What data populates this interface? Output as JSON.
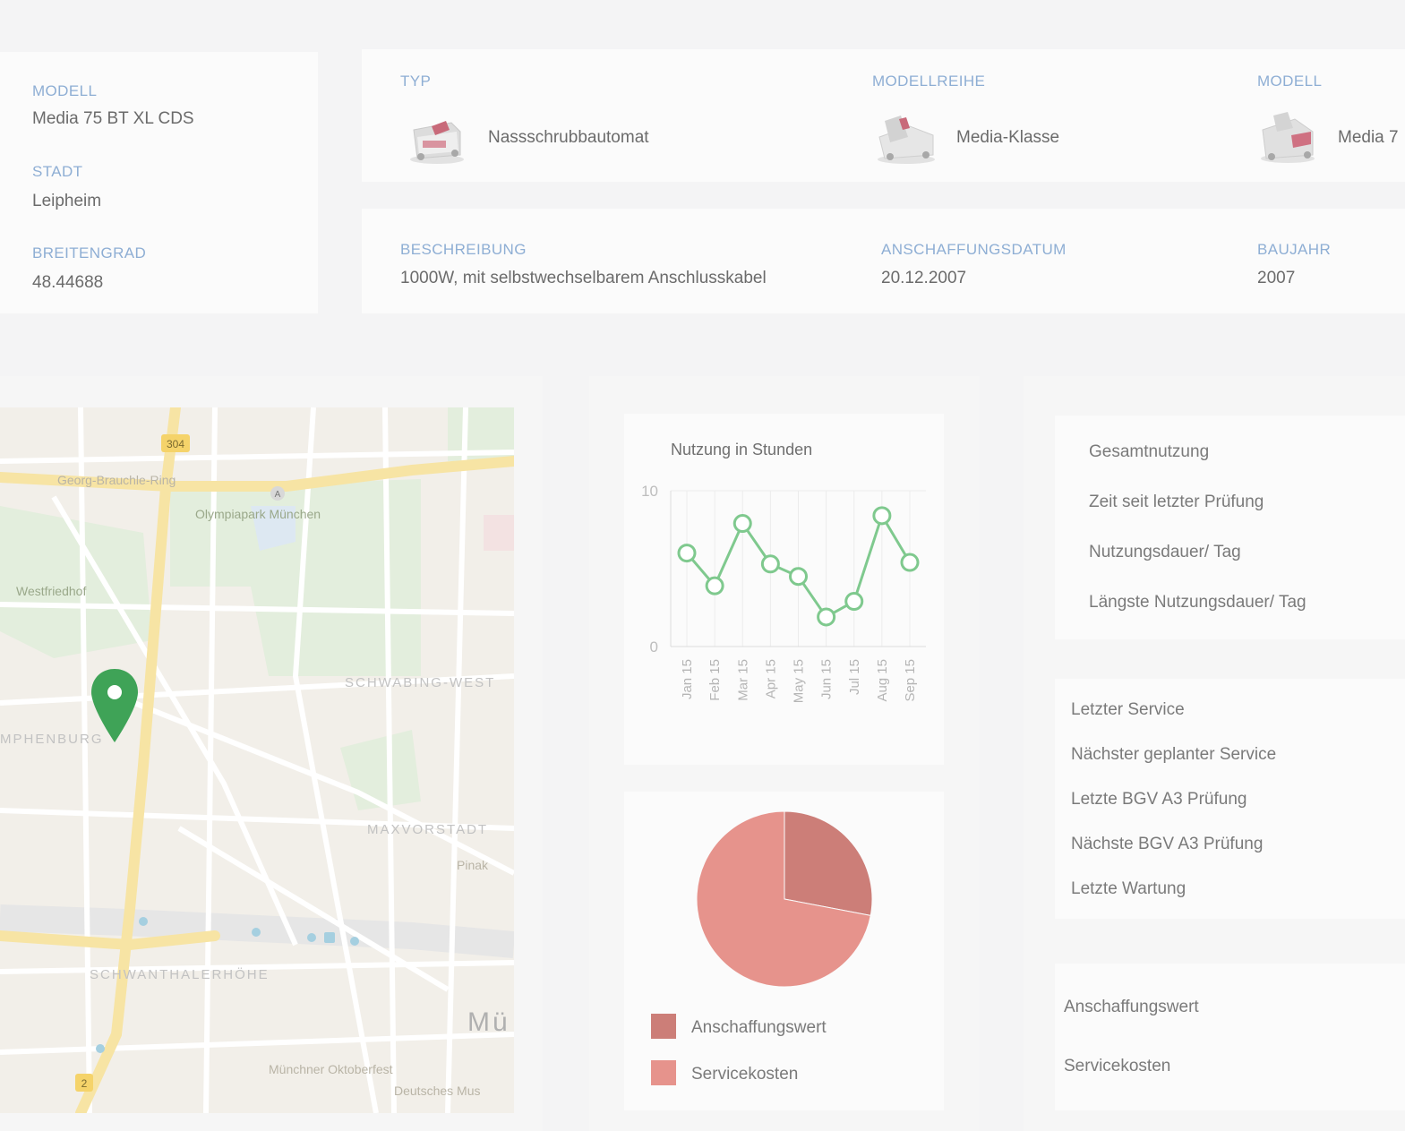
{
  "info_left": {
    "modell_label": "MODELL",
    "modell_value": "Media 75 BT XL CDS",
    "stadt_label": "STADT",
    "stadt_value": "Leipheim",
    "breitengrad_label": "BREITENGRAD",
    "breitengrad_value": "48.44688"
  },
  "type_card": {
    "typ_label": "TYP",
    "typ_value": "Nassschrubbautomat",
    "modellreihe_label": "MODELLREIHE",
    "modellreihe_value": "Media-Klasse",
    "modell_label": "MODELL",
    "modell_value": "Media 7"
  },
  "desc_card": {
    "beschreibung_label": "BESCHREIBUNG",
    "beschreibung_value": "1000W, mit selbstwechselbarem Anschlusskabel",
    "anschaffungsdatum_label": "ANSCHAFFUNGSDATUM",
    "anschaffungsdatum_value": "20.12.2007",
    "baujahr_label": "BAUJAHR",
    "baujahr_value": "2007"
  },
  "map": {
    "labels": {
      "road_304": "304",
      "georg": "Georg-Brauchle-Ring",
      "olympia": "Olympiapark München",
      "westfriedhof": "Westfriedhof",
      "schwabing": "SCHWABING-WEST",
      "nymphenburg": "MPHENBURG",
      "maxvorstadt": "MAXVORSTADT",
      "schwanthalerhoehe": "SCHWANTHALERHÖHE",
      "muenchen": "Mü",
      "oktoberfest": "Münchner Oktoberfest",
      "museum": "Deutsches Mus",
      "pinak": "Pinak",
      "a_marker": "A",
      "two": "2"
    },
    "pin_color": "#3fa357"
  },
  "chart_data": [
    {
      "type": "line",
      "title": "Nutzung in Stunden",
      "categories": [
        "Jan 15",
        "Feb 15",
        "Mar 15",
        "Apr 15",
        "May 15",
        "Jun 15",
        "Jul 15",
        "Aug 15",
        "Sep 15"
      ],
      "series": [
        {
          "values": [
            6,
            3.9,
            7.9,
            5.3,
            4.5,
            1.9,
            2.9,
            8.4,
            5.4
          ],
          "color": "#7fc98e"
        }
      ],
      "ylim": [
        0,
        10
      ],
      "yticks": [
        "0",
        "10"
      ],
      "grid": true
    },
    {
      "type": "pie",
      "labels": [
        "Anschaffungswert",
        "Servicekosten"
      ],
      "values": [
        28,
        72
      ],
      "colors": [
        "#cc7e78",
        "#e6938c"
      ]
    }
  ],
  "usage_card": {
    "items": [
      "Gesamtnutzung",
      "Zeit seit letzter Prüfung",
      "Nutzungsdauer/ Tag",
      "Längste Nutzungsdauer/ Tag"
    ]
  },
  "service_card": {
    "items": [
      "Letzter Service",
      "Nächster geplanter Service",
      "Letzte BGV A3 Prüfung",
      "Nächste BGV A3 Prüfung",
      "Letzte Wartung"
    ]
  },
  "cost_card": {
    "items": [
      "Anschaffungswert",
      "Servicekosten"
    ]
  }
}
